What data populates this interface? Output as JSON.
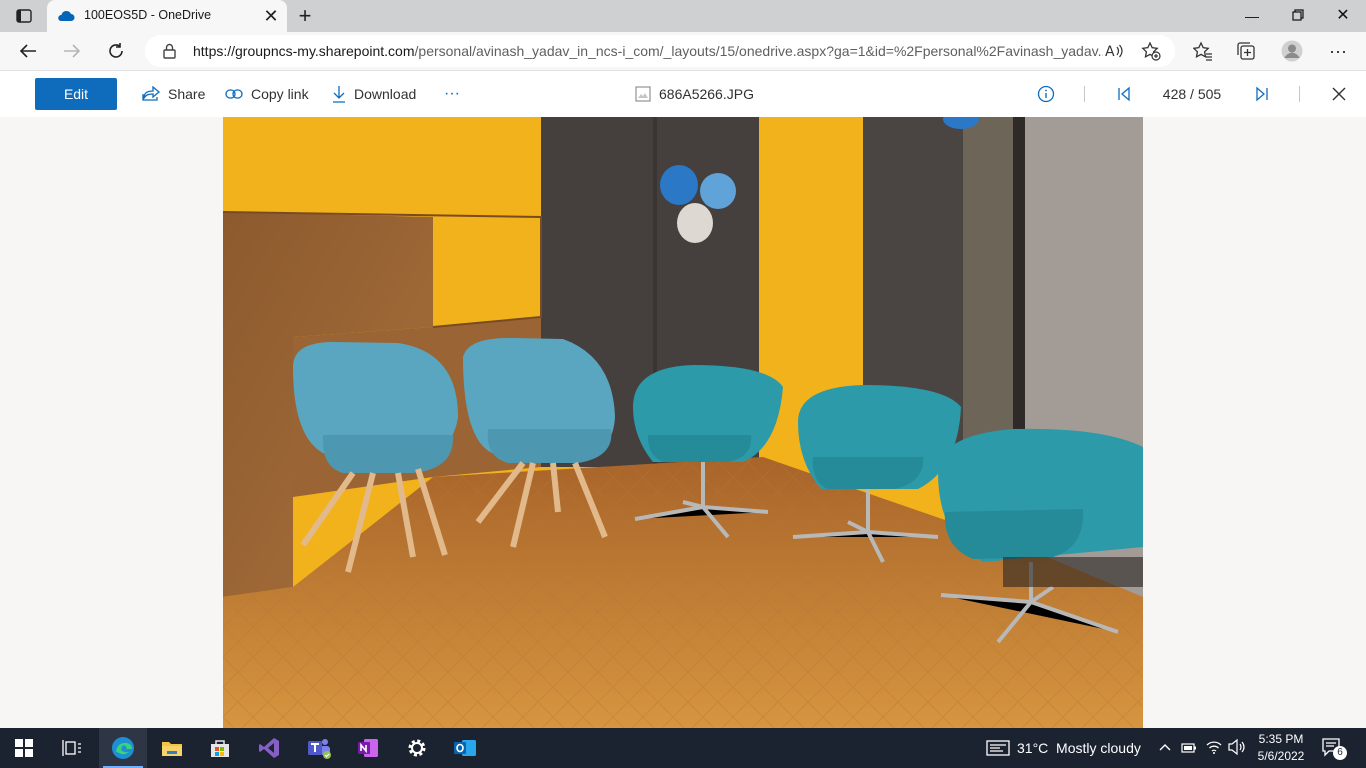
{
  "browser": {
    "tab_title": "100EOS5D - OneDrive",
    "url_host": "https://groupncs-my.sharepoint.com",
    "url_path": "/personal/avinash_yadav_in_ncs-i_com/_layouts/15/onedrive.aspx?ga=1&id=%2Fpersonal%2Favinash_yadav..."
  },
  "toolbar": {
    "edit_label": "Edit",
    "share_label": "Share",
    "copy_link_label": "Copy link",
    "download_label": "Download",
    "more_label": "···",
    "file_name": "686A5266.JPG",
    "position": "428 / 505"
  },
  "taskbar": {
    "weather": "31°C  Mostly cloudy",
    "time": "5:35 PM",
    "date": "5/6/2022",
    "notification_count": "6"
  },
  "colors": {
    "accent": "#0f6cbd",
    "taskbar": "#1b2230",
    "wall_yellow": "#f1b21c",
    "chair_teal": "#2c9aa8",
    "floor": "#c98a3a"
  }
}
